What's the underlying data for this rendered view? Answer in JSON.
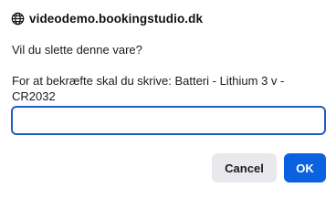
{
  "dialog": {
    "origin": "videodemo.bookingstudio.dk",
    "origin_icon": "globe-icon",
    "question": "Vil du slette denne vare?",
    "instruction": "For at bekræfte skal du skrive: Batteri - Lithium 3 v - CR2032",
    "input_value": "",
    "input_placeholder": "",
    "cancel_label": "Cancel",
    "ok_label": "OK"
  },
  "colors": {
    "accent": "#0b62e0",
    "input_border": "#1f5fbf",
    "cancel_bg": "#e9e9ed"
  }
}
